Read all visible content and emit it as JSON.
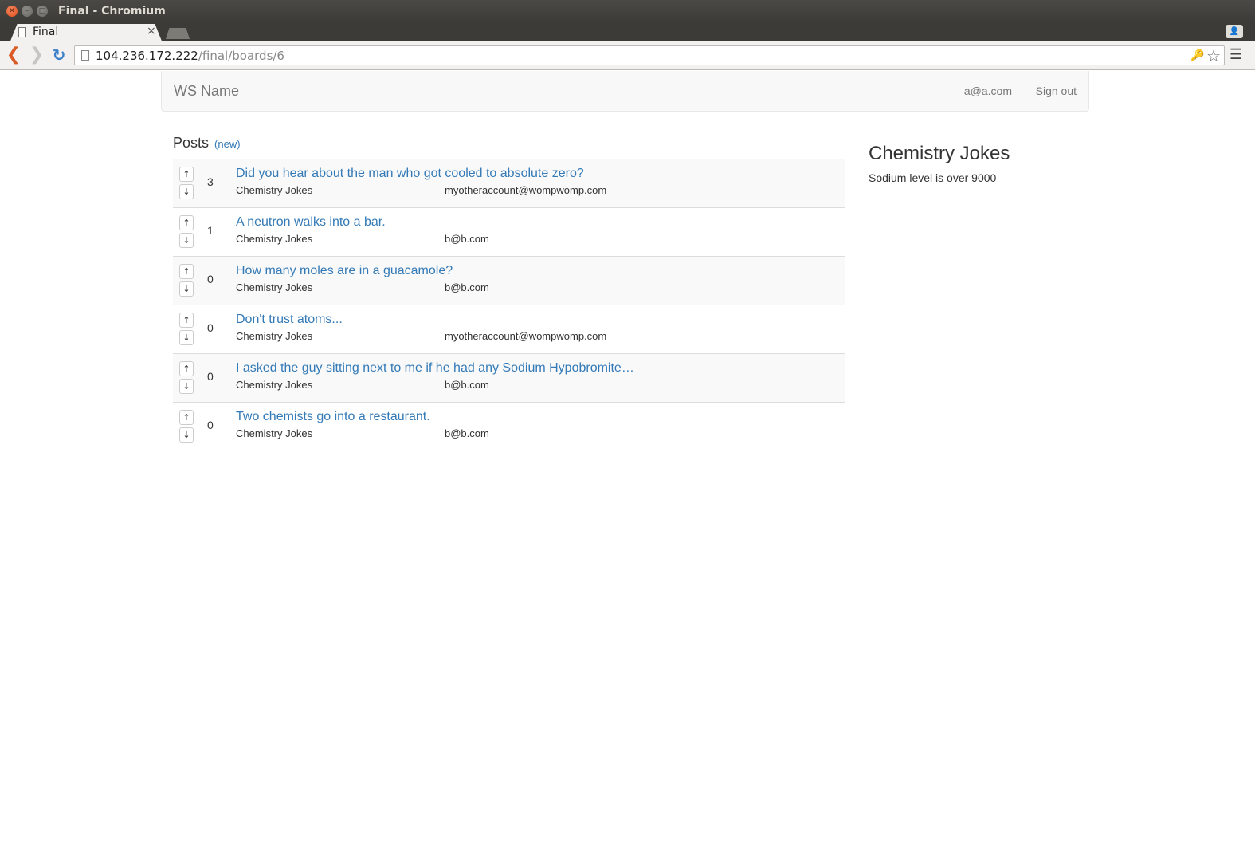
{
  "window": {
    "title": "Final - Chromium"
  },
  "tab": {
    "title": "Final"
  },
  "address_bar": {
    "host": "104.236.172.222",
    "path": "/final/boards/6"
  },
  "navbar": {
    "brand": "WS Name",
    "user": "a@a.com",
    "signout": "Sign out"
  },
  "posts": {
    "heading": "Posts",
    "new_link": "(new)",
    "items": [
      {
        "score": "3",
        "title": "Did you hear about the man who got cooled to absolute zero?",
        "board": "Chemistry Jokes",
        "author": "myotheraccount@wompwomp.com"
      },
      {
        "score": "1",
        "title": "A neutron walks into a bar.",
        "board": "Chemistry Jokes",
        "author": "b@b.com"
      },
      {
        "score": "0",
        "title": "How many moles are in a guacamole?",
        "board": "Chemistry Jokes",
        "author": "b@b.com"
      },
      {
        "score": "0",
        "title": "Don't trust atoms...",
        "board": "Chemistry Jokes",
        "author": "myotheraccount@wompwomp.com"
      },
      {
        "score": "0",
        "title": "I asked the guy sitting next to me if he had any Sodium Hypobromite…",
        "board": "Chemistry Jokes",
        "author": "b@b.com"
      },
      {
        "score": "0",
        "title": "Two chemists go into a restaurant.",
        "board": "Chemistry Jokes",
        "author": "b@b.com"
      }
    ],
    "vote_up": "↑",
    "vote_down": "↓"
  },
  "board": {
    "name": "Chemistry Jokes",
    "description": "Sodium level is over 9000"
  },
  "icons": {
    "close": "close-icon",
    "minimize": "minimize-icon",
    "maximize": "maximize-icon",
    "back": "back-arrow-icon",
    "forward": "forward-arrow-icon",
    "reload": "reload-icon",
    "bookmark": "star-icon",
    "menu": "hamburger-menu-icon"
  },
  "colors": {
    "link": "#337ab7",
    "navbar_bg": "#f8f8f8",
    "titlebar": "#3c3b37"
  }
}
